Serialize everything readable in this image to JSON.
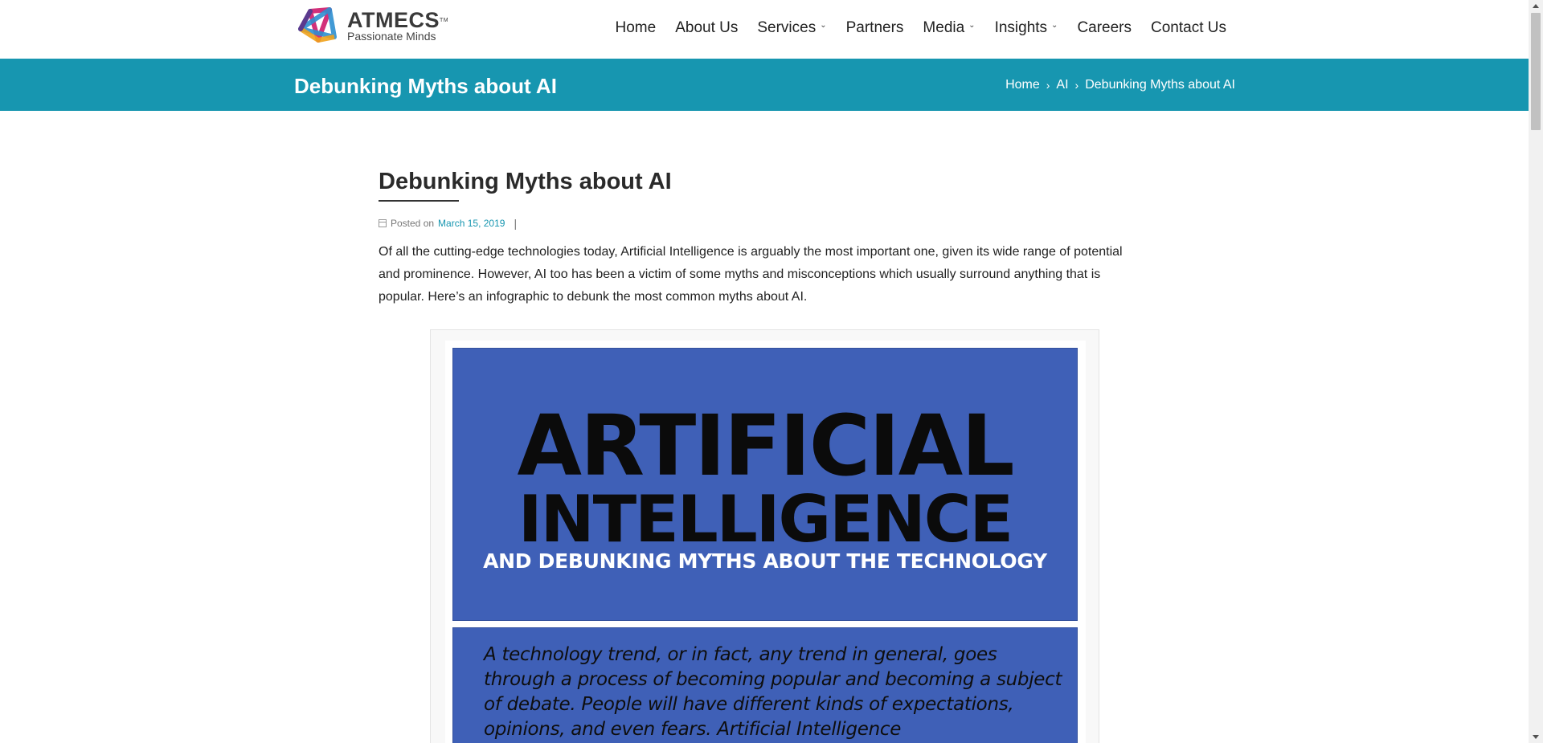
{
  "brand": {
    "name": "ATMECS",
    "trademark": "TM",
    "tagline": "Passionate Minds"
  },
  "nav": [
    {
      "label": "Home",
      "has_dropdown": false
    },
    {
      "label": "About Us",
      "has_dropdown": false
    },
    {
      "label": "Services",
      "has_dropdown": true
    },
    {
      "label": "Partners",
      "has_dropdown": false
    },
    {
      "label": "Media",
      "has_dropdown": true
    },
    {
      "label": "Insights",
      "has_dropdown": true
    },
    {
      "label": "Careers",
      "has_dropdown": false
    },
    {
      "label": "Contact Us",
      "has_dropdown": false
    }
  ],
  "band": {
    "title": "Debunking Myths about AI",
    "breadcrumb": [
      "Home",
      "AI",
      "Debunking Myths about AI"
    ],
    "separator": "›"
  },
  "article": {
    "title": "Debunking Myths about AI",
    "posted_prefix": "Posted on",
    "date": "March 15, 2019",
    "meta_divider": "|",
    "intro": "Of all the cutting-edge technologies today, Artificial Intelligence is arguably the most important one, given its wide range of potential and prominence. However, AI too has been a victim of some myths and misconceptions which usually surround anything that is popular. Here’s an infographic to debunk the most common myths about AI."
  },
  "infographic": {
    "line1": "ARTIFICIAL",
    "line2": "INTELLIGENCE",
    "subtitle": "AND DEBUNKING MYTHS ABOUT THE TECHNOLOGY",
    "body": "A technology trend, or in fact, any trend in general, goes through a process of becoming popular and becoming a subject of debate. People will have different kinds of expectations, opinions, and even fears. Artificial Intelligence"
  },
  "colors": {
    "accent": "#1796b0",
    "infographic_blue": "#3f60b7"
  }
}
